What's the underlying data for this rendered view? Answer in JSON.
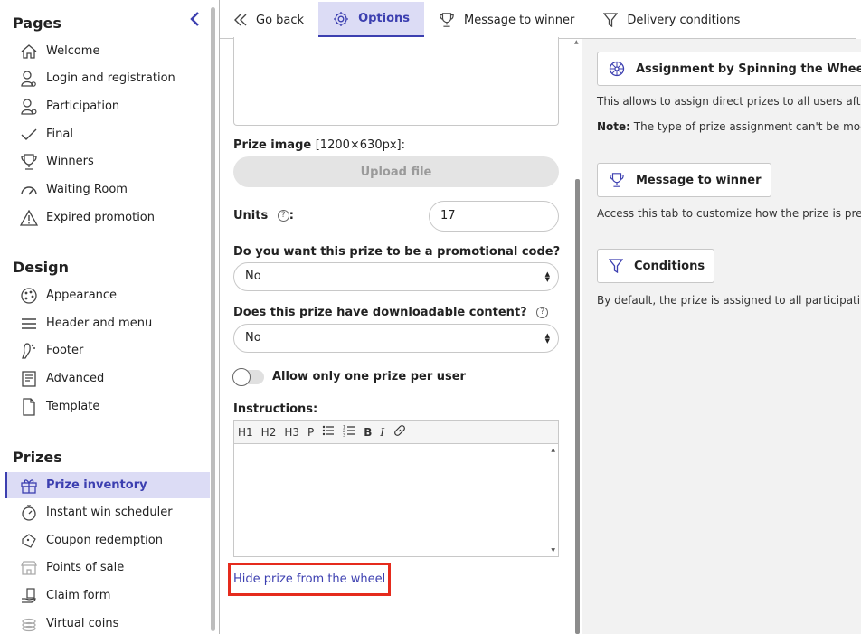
{
  "sidebar": {
    "sections": [
      {
        "title": "Pages",
        "items": [
          {
            "label": "Welcome",
            "icon": "house-icon"
          },
          {
            "label": "Login and registration",
            "icon": "user-key-icon"
          },
          {
            "label": "Participation",
            "icon": "user-gear-icon"
          },
          {
            "label": "Final",
            "icon": "checkmark-icon"
          },
          {
            "label": "Winners",
            "icon": "trophy-icon"
          },
          {
            "label": "Waiting Room",
            "icon": "speedometer-icon"
          },
          {
            "label": "Expired promotion",
            "icon": "warning-triangle-icon"
          }
        ]
      },
      {
        "title": "Design",
        "items": [
          {
            "label": "Appearance",
            "icon": "palette-icon"
          },
          {
            "label": "Header and menu",
            "icon": "hamburger-menu-icon"
          },
          {
            "label": "Footer",
            "icon": "footprint-icon"
          },
          {
            "label": "Advanced",
            "icon": "code-document-icon"
          },
          {
            "label": "Template",
            "icon": "blank-page-icon"
          }
        ]
      },
      {
        "title": "Prizes",
        "items": [
          {
            "label": "Prize inventory",
            "icon": "gift-icon",
            "active": true
          },
          {
            "label": "Instant win scheduler",
            "icon": "stopwatch-icon"
          },
          {
            "label": "Coupon redemption",
            "icon": "coupon-icon"
          },
          {
            "label": "Points of sale",
            "icon": "store-icon"
          },
          {
            "label": "Claim form",
            "icon": "hand-form-icon"
          },
          {
            "label": "Virtual coins",
            "icon": "coins-icon"
          }
        ]
      }
    ]
  },
  "tabs": [
    {
      "label": "Go back",
      "icon": "double-chevron-left-icon"
    },
    {
      "label": "Options",
      "icon": "gear-icon",
      "active": true
    },
    {
      "label": "Message to winner",
      "icon": "trophy-icon"
    },
    {
      "label": "Delivery conditions",
      "icon": "funnel-icon"
    }
  ],
  "form": {
    "prize_image_label": "Prize image",
    "prize_image_size": "[1200×630px]:",
    "upload_label": "Upload file",
    "units_label": "Units",
    "units_value": "17",
    "promo_code_label": "Do you want this prize to be a promotional code?",
    "promo_code_value": "No",
    "downloadable_label": "Does this prize have downloadable content?",
    "downloadable_value": "No",
    "one_prize_label": "Allow only one prize per user",
    "one_prize_enabled": false,
    "instructions_label": "Instructions:",
    "editor_tools": [
      "H1",
      "H2",
      "H3",
      "P"
    ],
    "hide_link": "Hide prize from the wheel"
  },
  "info": {
    "assignment_button": "Assignment by Spinning the Wheel",
    "assignment_text": "This allows to assign direct prizes to all users aft",
    "note_label": "Note:",
    "note_text": "The type of prize assignment can't be mod",
    "message_button": "Message to winner",
    "message_text": "Access this tab to customize how the prize is pre",
    "conditions_button": "Conditions",
    "conditions_text": "By default, the prize is assigned to all participati"
  },
  "colors": {
    "accent": "#3c3fb0",
    "active_bg": "#dcdcf5",
    "highlight": "#e52b1d"
  }
}
